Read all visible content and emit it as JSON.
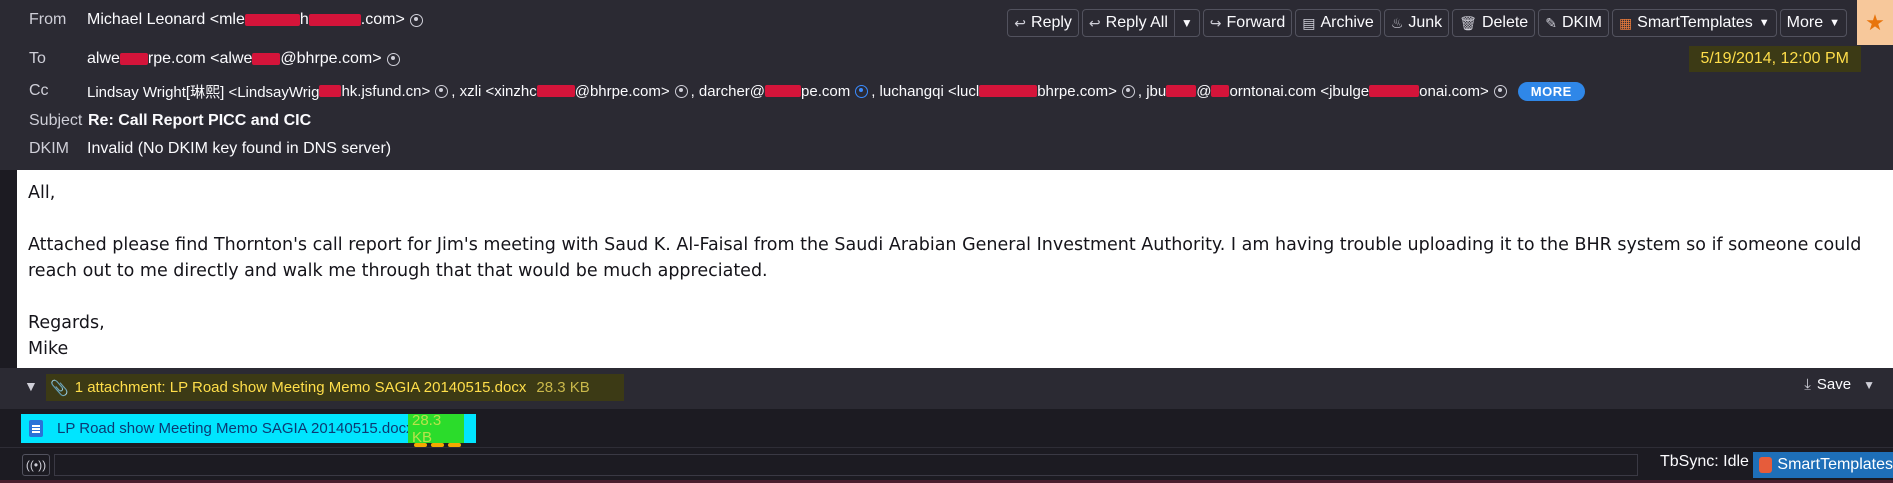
{
  "header": {
    "from": {
      "label": "From",
      "value_prefix": "Michael Leonard <mle",
      "value_mid": "h",
      "value_suffix": ".com>"
    },
    "to": {
      "label": "To",
      "v1": "alwe",
      "v2": "rpe.com <alwe",
      "v3": "@bhrpe.com>"
    },
    "cc": {
      "label": "Cc",
      "c1": "Lindsay Wright[琳熙] <LindsayWrig",
      "c1b": "hk.jsfund.cn>",
      "c2": ", xzli <xinzhc",
      "c2b": "@bhrpe.com>",
      "c3": ", darcher@",
      "c3b": "pe.com",
      "c4": ", luchangqi <lucl",
      "c4b": "bhrpe.com>",
      "c5": ", jbu",
      "c5b": "@",
      "c5c": "orntonai.com <jbulge",
      "c5d": "onai.com>",
      "more": "MORE"
    },
    "subject": {
      "label": "Subject",
      "value": "Re: Call Report PICC and CIC"
    },
    "dkim": {
      "label": "DKIM",
      "value": "Invalid (No DKIM key found in DNS server)"
    },
    "date": "5/19/2014, 12:00 PM"
  },
  "toolbar": {
    "reply": "Reply",
    "reply_all": "Reply All",
    "forward": "Forward",
    "archive": "Archive",
    "junk": "Junk",
    "delete": "Delete",
    "dkim": "DKIM",
    "smart_templates": "SmartTemplates",
    "more": "More"
  },
  "message": {
    "greeting": "All,",
    "para": "Attached please find Thornton's call report for Jim's meeting with Saud K. Al-Faisal from the Saudi Arabian General Investment Authority. I am having trouble uploading it to the BHR system so if someone could reach out to me directly and walk me through that that would be much appreciated.",
    "closing": "Regards,",
    "signature": "Mike"
  },
  "attachments": {
    "summary": "1 attachment: LP Road show Meeting Memo SAGIA 20140515.docx",
    "summary_size": "28.3 KB",
    "save": "Save",
    "items": [
      {
        "name": "LP Road show Meeting Memo SAGIA 20140515.docx",
        "size": "28.3 KB"
      }
    ]
  },
  "statusbar": {
    "tbsync": "TbSync: Idle",
    "smart_templates": "SmartTemplates"
  },
  "colors": {
    "header_bg": "#2b2a33",
    "accent_blue": "#2f87e8",
    "date_highlight": "#ffde4a",
    "attachment_highlight": "#00e5ff",
    "redaction": "#d4143a"
  }
}
